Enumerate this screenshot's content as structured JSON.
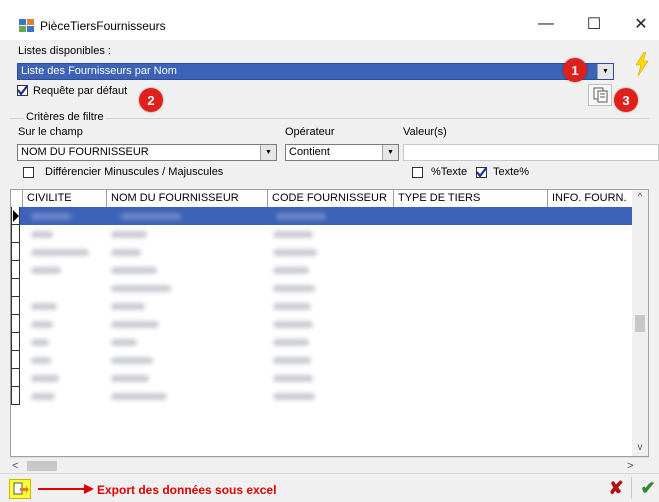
{
  "window": {
    "title": "PièceTiersFournisseurs",
    "minimize": "—",
    "maximize": "☐",
    "close": "✕"
  },
  "lists": {
    "label": "Listes disponibles :",
    "selected": "Liste des Fournisseurs par Nom"
  },
  "default_query": {
    "label": "Requête par défaut",
    "checked": true
  },
  "filter": {
    "group_label": "Critères de filtre",
    "field_label": "Sur le champ",
    "field_value": "NOM DU FOURNISSEUR",
    "operator_label": "Opérateur",
    "operator_value": "Contient",
    "values_label": "Valeur(s)",
    "values_value": "",
    "case_label": "Différencier Minuscules / Majuscules",
    "pct_text_label": "%Texte",
    "text_pct_label": "Texte%",
    "text_pct_checked": true
  },
  "badges": [
    "1",
    "2",
    "3"
  ],
  "grid": {
    "columns": [
      "CIVILITE",
      "NOM DU FOURNISSEUR",
      "CODE FOURNISSEUR",
      "TYPE DE TIERS",
      "INFO. FOURN."
    ],
    "scroll_left": "<",
    "scroll_right": ">",
    "scroll_up": "^",
    "scroll_down": "v"
  },
  "footer": {
    "export_label": "Export des données sous excel",
    "cancel": "✘",
    "confirm": "✔"
  },
  "colors": {
    "selection": "#3d63b8",
    "badge": "#e0201b",
    "export_text": "#e00000",
    "accent_bolt": "#ffd800",
    "export_button": "#ffff33"
  },
  "icons": [
    "app-icon",
    "lightning-icon",
    "copy-query-icon",
    "export-excel-icon",
    "arrow-right-icon",
    "cancel-icon",
    "confirm-icon"
  ]
}
